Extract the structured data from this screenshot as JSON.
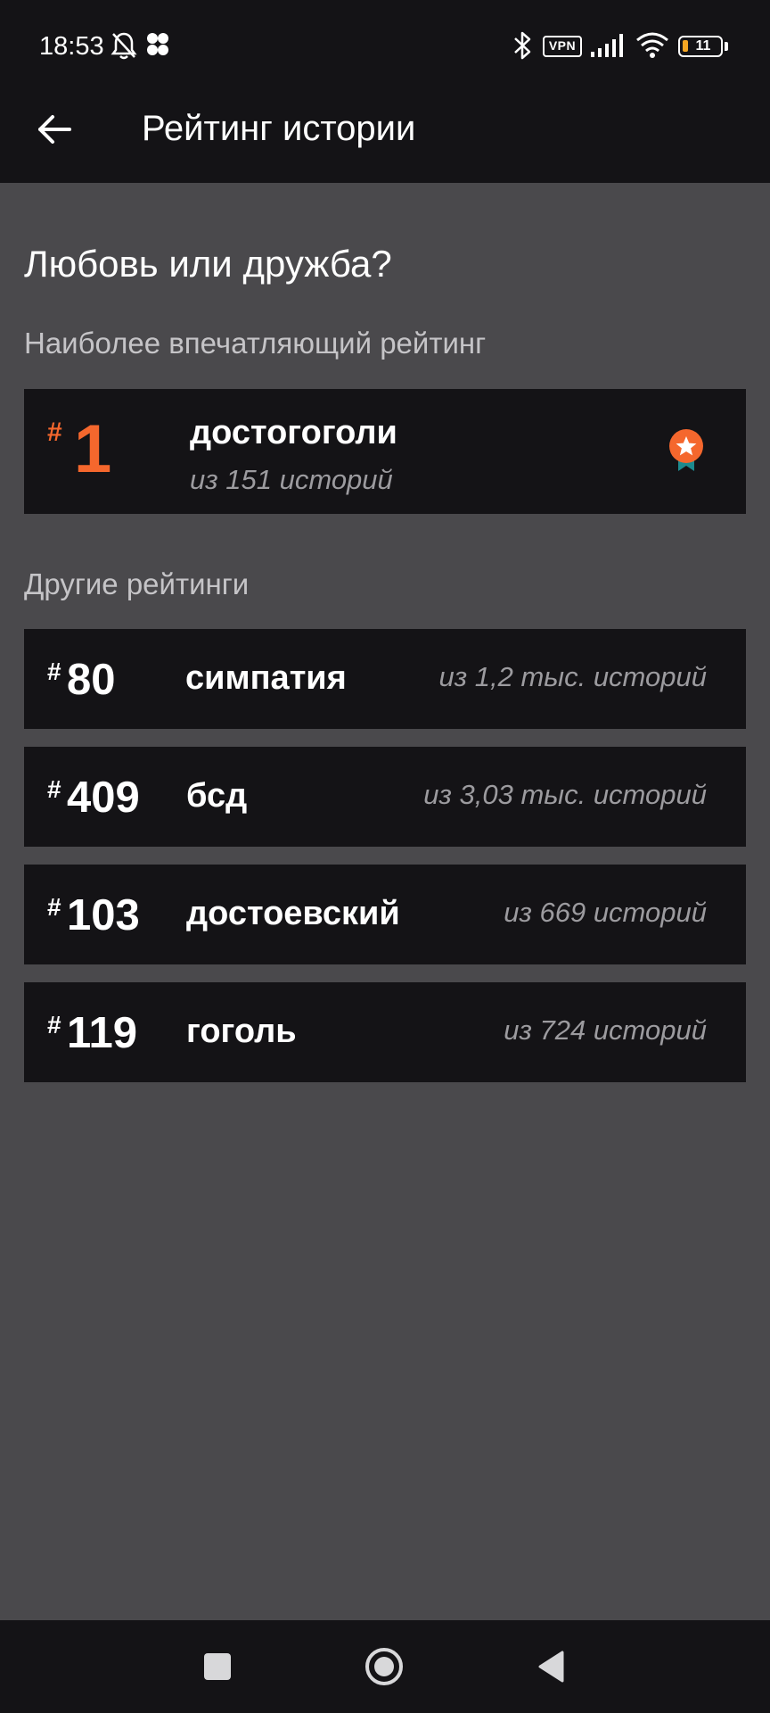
{
  "status_bar": {
    "time": "18:53",
    "vpn_label": "VPN",
    "battery_level": "11",
    "icons": [
      "mute-bell-icon",
      "fan-icon",
      "bluetooth-icon",
      "vpn-icon",
      "signal-icon",
      "wifi-icon",
      "battery-icon"
    ]
  },
  "app_bar": {
    "title": "Рейтинг истории",
    "back_icon": "arrow-left-icon"
  },
  "story": {
    "title": "Любовь или дружба?"
  },
  "best_section": {
    "label": "Наиболее впечатляющий рейтинг",
    "hash": "#",
    "rank": "1",
    "tag": "достогоголи",
    "count": "из 151 историй",
    "icon": "medal-icon",
    "accent_color": "#f5672d"
  },
  "other_section": {
    "label": "Другие рейтинги",
    "items": [
      {
        "hash": "#",
        "rank": "80",
        "tag": "симпатия",
        "count": "из 1,2 тыс. историй"
      },
      {
        "hash": "#",
        "rank": "409",
        "tag": "бсд",
        "count": "из 3,03 тыс. историй"
      },
      {
        "hash": "#",
        "rank": "103",
        "tag": "достоевский",
        "count": "из 669 историй"
      },
      {
        "hash": "#",
        "rank": "119",
        "tag": "гоголь",
        "count": "из 724 историй"
      }
    ]
  },
  "nav_bar": {
    "buttons": [
      "recents-square-icon",
      "home-circle-icon",
      "back-triangle-icon"
    ]
  }
}
